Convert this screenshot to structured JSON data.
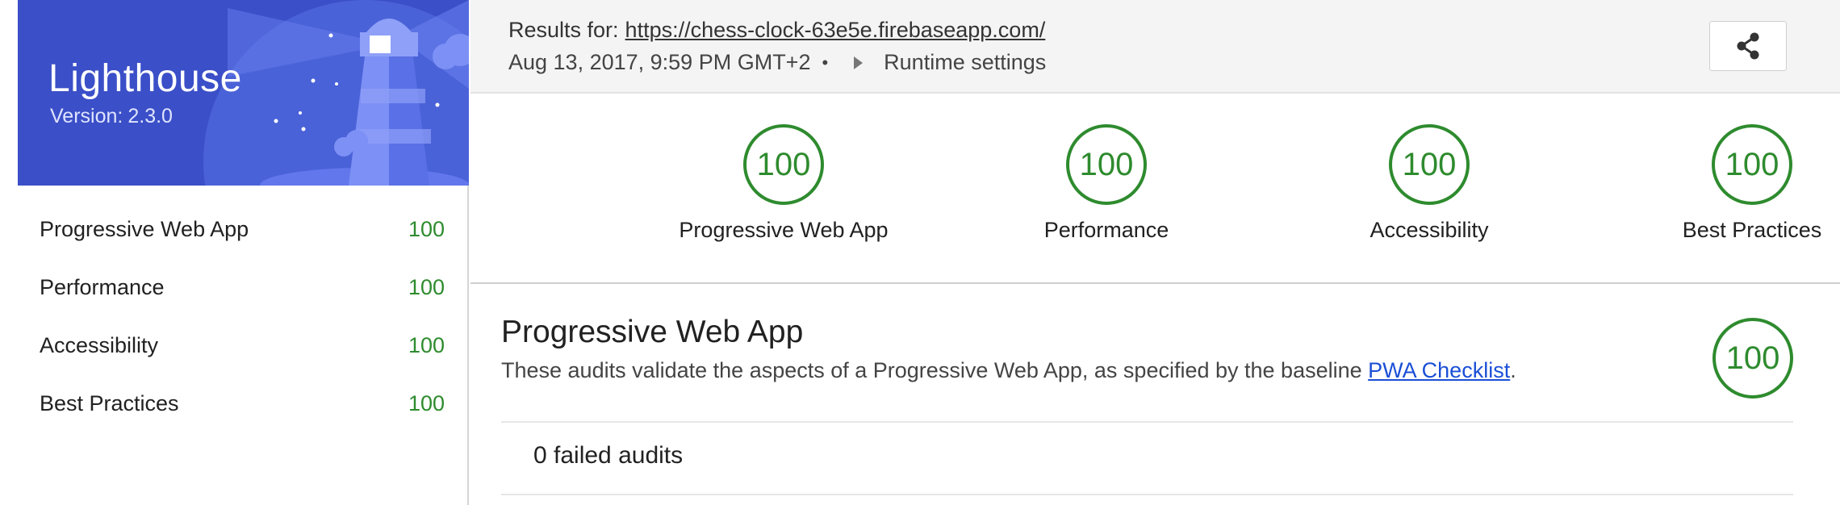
{
  "app": {
    "name": "Lighthouse",
    "version_label": "Version:",
    "version": "2.3.0"
  },
  "sidebar": {
    "items": [
      {
        "label": "Progressive Web App",
        "score": "100"
      },
      {
        "label": "Performance",
        "score": "100"
      },
      {
        "label": "Accessibility",
        "score": "100"
      },
      {
        "label": "Best Practices",
        "score": "100"
      }
    ]
  },
  "header": {
    "results_label": "Results for:",
    "url": "https://chess-clock-63e5e.firebaseapp.com/",
    "date": "Aug 13, 2017, 9:59 PM GMT+2",
    "separator": "•",
    "runtime_settings": "Runtime settings",
    "share_icon": "share-icon"
  },
  "gauges": [
    {
      "label": "Progressive Web App",
      "score": "100"
    },
    {
      "label": "Performance",
      "score": "100"
    },
    {
      "label": "Accessibility",
      "score": "100"
    },
    {
      "label": "Best Practices",
      "score": "100"
    }
  ],
  "section": {
    "title": "Progressive Web App",
    "description": "These audits validate the aspects of a Progressive Web App, as specified by the baseline",
    "link_text": "PWA Checklist",
    "period": ".",
    "score": "100",
    "failed_audits": "0 failed audits"
  },
  "colors": {
    "banner": "#3b4fc8",
    "pass": "#2e8b2e",
    "link": "#1a4fd6"
  }
}
